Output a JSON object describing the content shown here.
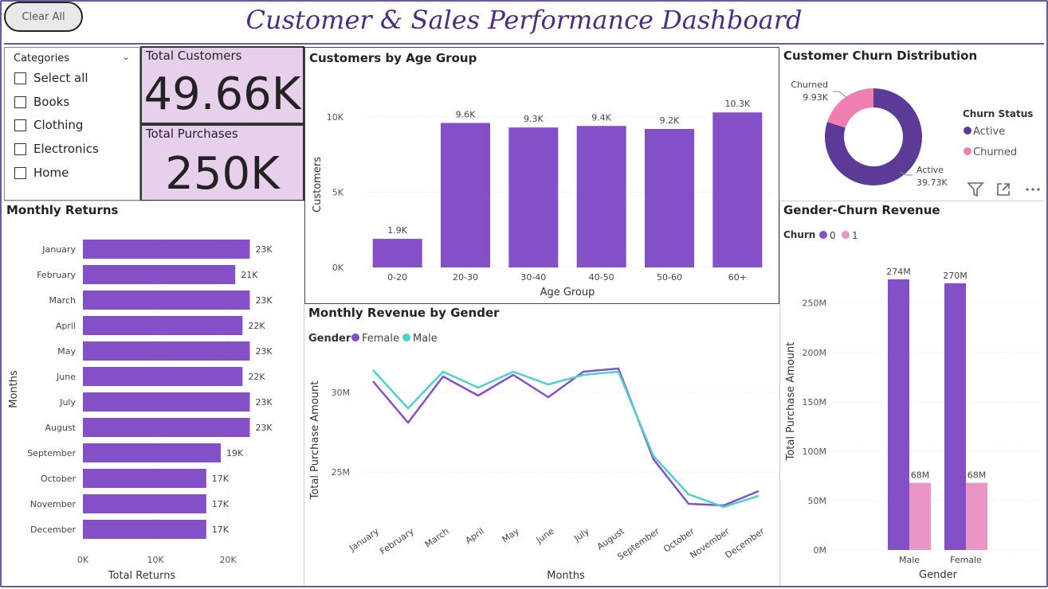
{
  "header": {
    "clear_label": "Clear All",
    "title": "Customer & Sales Performance Dashboard"
  },
  "slicer": {
    "title": "Categories",
    "items": [
      "Select all",
      "Books",
      "Clothing",
      "Electronics",
      "Home"
    ]
  },
  "kpis": {
    "customers": {
      "label": "Total Customers",
      "value": "49.66K"
    },
    "purchases": {
      "label": "Total Purchases",
      "value": "250K"
    }
  },
  "icons": {
    "filter": "filter-icon",
    "focus": "focus-mode-icon",
    "more": "more-options-icon"
  },
  "colors": {
    "purple": "#8350c8",
    "teal": "#4fcfcf",
    "pink": "#e995c5",
    "dark_purple": "#5c3a97",
    "churn_pink": "#ef7fb0"
  },
  "chart_data": [
    {
      "id": "age",
      "type": "bar",
      "title": "Customers by Age Group",
      "xlabel": "Age Group",
      "ylabel": "Customers",
      "categories": [
        "0-20",
        "20-30",
        "30-40",
        "40-50",
        "50-60",
        "60+"
      ],
      "values": [
        1900,
        9600,
        9300,
        9400,
        9200,
        10300
      ],
      "labels": [
        "1.9K",
        "9.6K",
        "9.3K",
        "9.4K",
        "9.2K",
        "10.3K"
      ],
      "yticks": [
        {
          "v": 0,
          "t": "0K"
        },
        {
          "v": 5000,
          "t": "5K"
        },
        {
          "v": 10000,
          "t": "10K"
        }
      ],
      "ylim": [
        0,
        11000
      ]
    },
    {
      "id": "returns",
      "type": "bar",
      "orientation": "horizontal",
      "title": "Monthly Returns",
      "xlabel": "Total Returns",
      "ylabel": "Months",
      "categories": [
        "January",
        "February",
        "March",
        "April",
        "May",
        "June",
        "July",
        "August",
        "September",
        "October",
        "November",
        "December"
      ],
      "values": [
        23000,
        21000,
        23000,
        22000,
        23000,
        22000,
        23000,
        23000,
        19000,
        17000,
        17000,
        17000
      ],
      "labels": [
        "23K",
        "21K",
        "23K",
        "22K",
        "23K",
        "22K",
        "23K",
        "23K",
        "19K",
        "17K",
        "17K",
        "17K"
      ],
      "xticks": [
        {
          "v": 0,
          "t": "0K"
        },
        {
          "v": 10000,
          "t": "10K"
        },
        {
          "v": 20000,
          "t": "20K"
        }
      ],
      "xlim": [
        0,
        23500
      ]
    },
    {
      "id": "churn",
      "type": "pie",
      "title": "Customer Churn Distribution",
      "legend_title": "Churn Status",
      "slices": [
        {
          "name": "Active",
          "value": 39730,
          "label": "39.73K"
        },
        {
          "name": "Churned",
          "value": 9930,
          "label": "9.93K"
        }
      ]
    },
    {
      "id": "gender_rev",
      "type": "line",
      "title": "Monthly Revenue by Gender",
      "legend_title": "Gender",
      "xlabel": "Months",
      "ylabel": "Total Purchase Amount",
      "categories": [
        "January",
        "February",
        "March",
        "April",
        "May",
        "June",
        "July",
        "August",
        "September",
        "October",
        "November",
        "December"
      ],
      "series": [
        {
          "name": "Female",
          "values": [
            30.7,
            28.1,
            31.0,
            29.8,
            31.1,
            29.7,
            31.3,
            31.5,
            25.8,
            23.0,
            22.9,
            23.8
          ]
        },
        {
          "name": "Male",
          "values": [
            31.4,
            29.0,
            31.3,
            30.3,
            31.3,
            30.5,
            31.1,
            31.3,
            26.0,
            23.6,
            22.8,
            23.5
          ]
        }
      ],
      "yticks": [
        {
          "v": 25,
          "t": "25M"
        },
        {
          "v": 30,
          "t": "30M"
        }
      ],
      "ylim": [
        22.0,
        32.5
      ]
    },
    {
      "id": "gender_churn",
      "type": "bar",
      "title": "Gender-Churn Revenue",
      "legend_title": "Churn",
      "xlabel": "Gender",
      "ylabel": "Total Purchase Amount",
      "categories": [
        "Male",
        "Female"
      ],
      "series": [
        {
          "name": "0",
          "values": [
            274,
            270
          ],
          "labels": [
            "274M",
            "270M"
          ]
        },
        {
          "name": "1",
          "values": [
            68,
            68
          ],
          "labels": [
            "68M",
            "68M"
          ]
        }
      ],
      "yticks": [
        {
          "v": 0,
          "t": "0M"
        },
        {
          "v": 50,
          "t": "50M"
        },
        {
          "v": 100,
          "t": "100M"
        },
        {
          "v": 150,
          "t": "150M"
        },
        {
          "v": 200,
          "t": "200M"
        },
        {
          "v": 250,
          "t": "250M"
        }
      ],
      "ylim": [
        0,
        282
      ]
    }
  ]
}
